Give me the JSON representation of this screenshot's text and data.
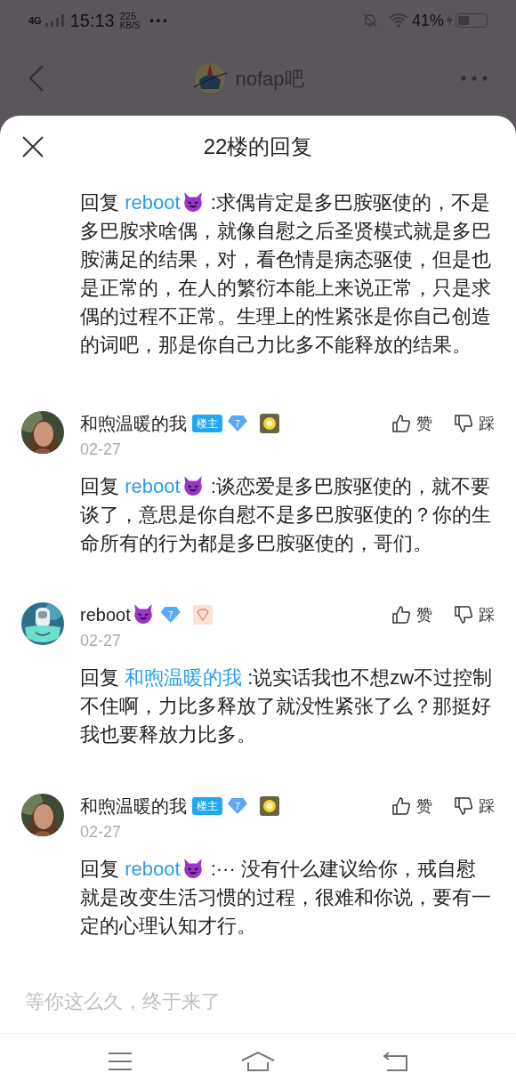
{
  "status_bar": {
    "network": "4G",
    "time": "15:13",
    "speed": "225",
    "speed_unit": "KB/S",
    "more": "···",
    "battery": "41%"
  },
  "header": {
    "title": "nofap吧"
  },
  "sheet": {
    "title": "22楼的回复"
  },
  "comments": [
    {
      "reply_prefix": "回复",
      "reply_to": "reboot",
      "reply_to_emoji": true,
      "text": ":求偶肯定是多巴胺驱使的，不是多巴胺求啥偶，就像自慰之后圣贤模式就是多巴胺满足的结果，对，看色情是病态驱使，但是也是正常的，在人的繁衍本能上来说正常，只是求偶的过程不正常。生理上的性紧张是你自己创造的词吧，那是你自己力比多不能释放的结果。"
    },
    {
      "author": {
        "name": "和煦温暖的我",
        "name_emoji": false,
        "op_badge": "楼主",
        "level": "7"
      },
      "date": "02-27",
      "like": "赞",
      "dislike": "踩",
      "reply_prefix": "回复",
      "reply_to": "reboot",
      "reply_to_emoji": true,
      "text": ":谈恋爱是多巴胺驱使的，就不要谈了，意思是你自慰不是多巴胺驱使的？你的生命所有的行为都是多巴胺驱使的，哥们。"
    },
    {
      "author": {
        "name": "reboot",
        "name_emoji": true,
        "level": "7"
      },
      "date": "02-27",
      "like": "赞",
      "dislike": "踩",
      "reply_prefix": "回复",
      "reply_to": "和煦温暖的我",
      "reply_to_emoji": false,
      "text": ":说实话我也不想zw不过控制不住啊，力比多释放了就没性紧张了么？那挺好我也要释放力比多。"
    },
    {
      "author": {
        "name": "和煦温暖的我",
        "name_emoji": false,
        "op_badge": "楼主",
        "level": "7"
      },
      "date": "02-27",
      "like": "赞",
      "dislike": "踩",
      "reply_prefix": "回复",
      "reply_to": "reboot",
      "reply_to_emoji": true,
      "text": ":··· 没有什么建议给你，戒自慰就是改变生活习惯的过程，很难和你说，要有一定的心理认知才行。"
    }
  ],
  "input": {
    "placeholder": "等你这么久，终于来了"
  }
}
